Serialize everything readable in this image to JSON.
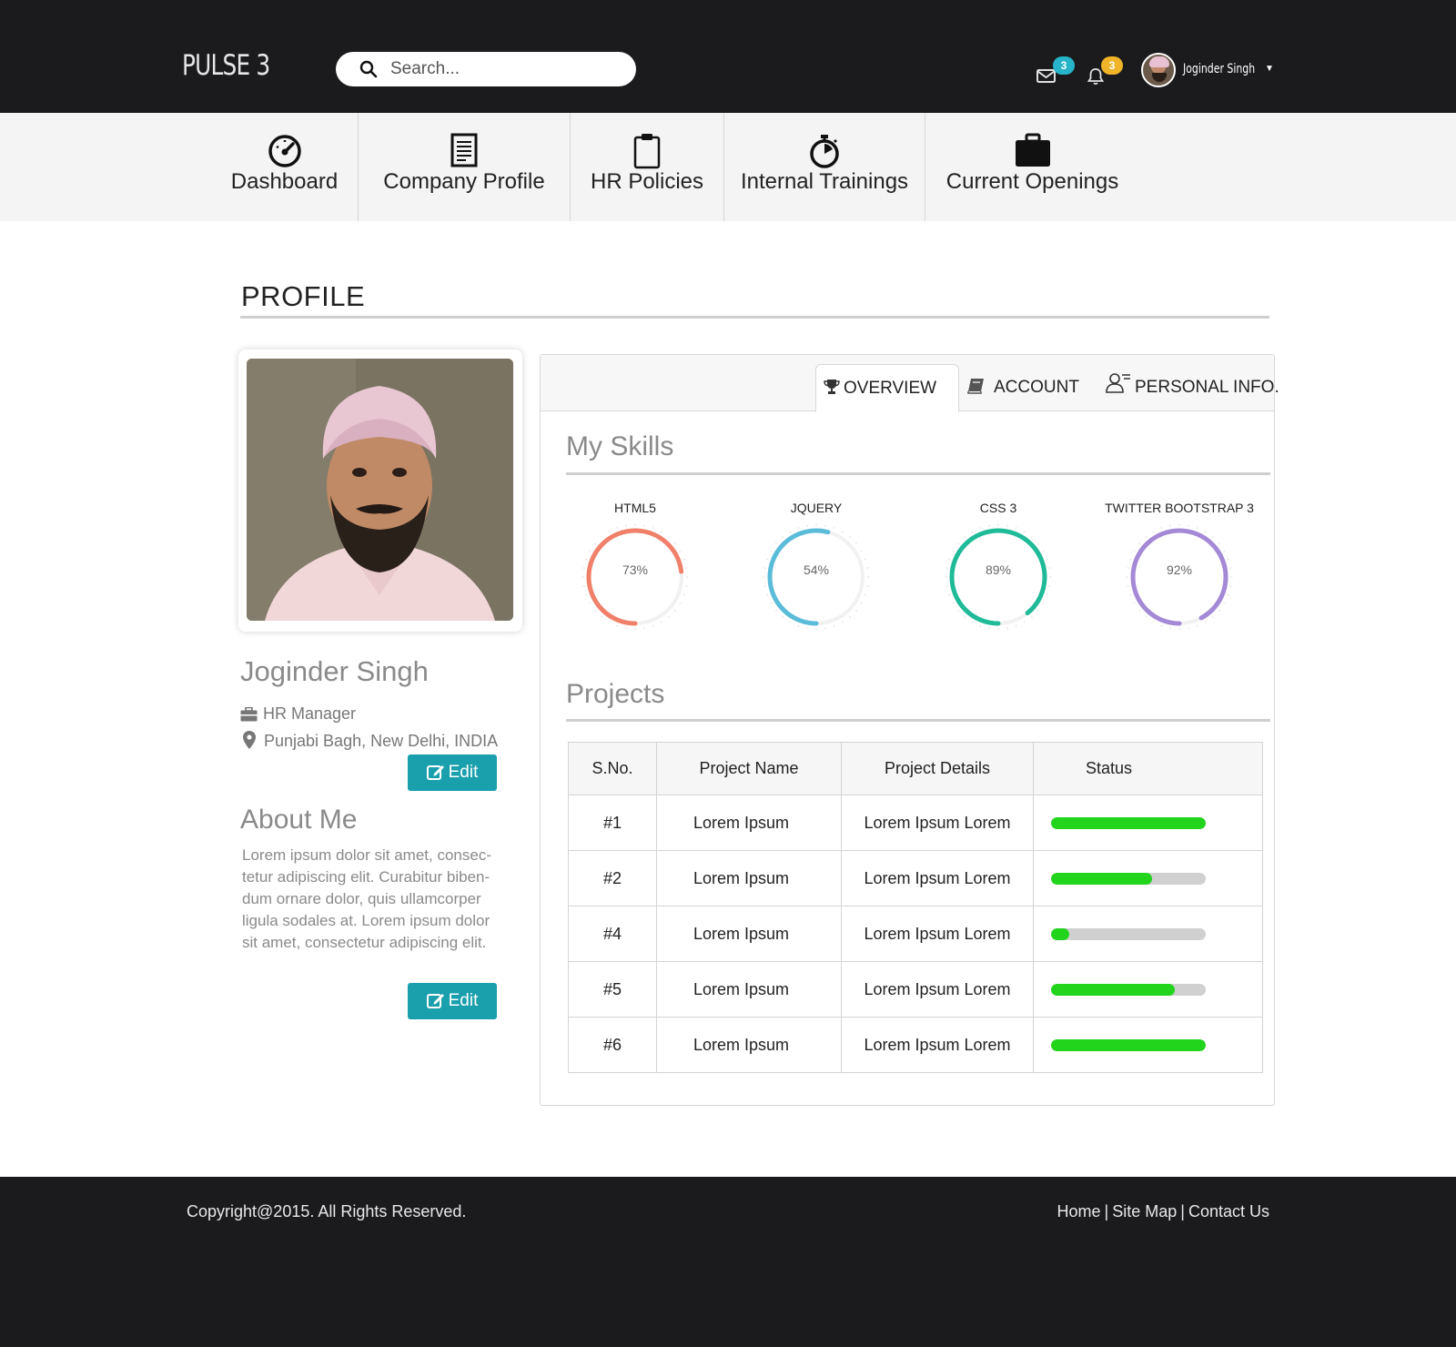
{
  "header": {
    "logo": "PULSE 3",
    "search_placeholder": "Search...",
    "messages_count": "3",
    "notifications_count": "3",
    "user_name": "Joginder Singh",
    "colors": {
      "messages_badge": "#27b3c8",
      "notifications_badge": "#f0b428"
    }
  },
  "nav": {
    "items": [
      {
        "label": "Dashboard",
        "icon": "speedometer-icon"
      },
      {
        "label": "Company Profile",
        "icon": "document-icon"
      },
      {
        "label": "HR Policies",
        "icon": "clipboard-icon"
      },
      {
        "label": "Internal Trainings",
        "icon": "stopwatch-icon"
      },
      {
        "label": "Current Openings",
        "icon": "briefcase-icon"
      }
    ]
  },
  "page": {
    "title": "PROFILE"
  },
  "profile": {
    "name": "Joginder Singh",
    "role": "HR Manager",
    "location": "Punjabi Bagh, New Delhi, INDIA",
    "edit_label": "Edit",
    "about_title": "About Me",
    "about_text": "Lorem ipsum dolor sit amet, consec-tetur adipiscing elit. Curabitur biben-dum ornare dolor, quis ullamcorper ligula sodales at. Lorem ipsum dolor sit amet, consectetur adipiscing elit.",
    "about_edit_label": "Edit"
  },
  "tabs": {
    "items": [
      {
        "label": "OVERVIEW",
        "icon": "trophy-icon"
      },
      {
        "label": "ACCOUNT",
        "icon": "book-icon"
      },
      {
        "label": "PERSONAL INFO.",
        "icon": "user-list-icon"
      }
    ],
    "active": "OVERVIEW"
  },
  "skills": {
    "title": "My Skills",
    "items": [
      {
        "name": "HTML5",
        "value": 73,
        "label": "73%",
        "color": "#f0806a"
      },
      {
        "name": "JQUERY",
        "value": 54,
        "label": "54%",
        "color": "#5bbcda"
      },
      {
        "name": "CSS 3",
        "value": 89,
        "label": "89%",
        "color": "#1fba98"
      },
      {
        "name": "TWITTER BOOTSTRAP 3",
        "value": 92,
        "label": "92%",
        "color": "#a489d6"
      }
    ]
  },
  "projects": {
    "title": "Projects",
    "columns": [
      "S.No.",
      "Project Name",
      "Project Details",
      "Status"
    ],
    "rows": [
      {
        "sno": "#1",
        "name": "Lorem Ipsum",
        "details": "Lorem Ipsum Lorem",
        "progress": 100
      },
      {
        "sno": "#2",
        "name": "Lorem Ipsum",
        "details": "Lorem Ipsum Lorem",
        "progress": 65
      },
      {
        "sno": "#4",
        "name": "Lorem Ipsum",
        "details": "Lorem Ipsum Lorem",
        "progress": 12
      },
      {
        "sno": "#5",
        "name": "Lorem Ipsum",
        "details": "Lorem Ipsum Lorem",
        "progress": 80
      },
      {
        "sno": "#6",
        "name": "Lorem Ipsum",
        "details": "Lorem Ipsum Lorem",
        "progress": 100
      }
    ],
    "status_color": "#22d41c"
  },
  "footer": {
    "copyright": "Copyright@2015. All Rights Reserved.",
    "links": [
      "Home",
      "Site Map",
      "Contact Us"
    ],
    "separator": "|"
  }
}
